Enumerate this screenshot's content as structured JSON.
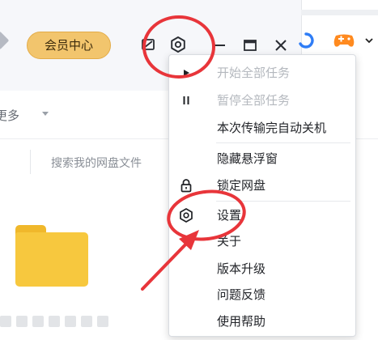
{
  "window": {
    "vip_button": "会员中心",
    "icons": [
      "left-partial-icon",
      "mail-icon",
      "settings-icon",
      "minimize-icon",
      "maximize-icon",
      "close-icon"
    ]
  },
  "taskbar": {
    "icons": [
      "browser-icon",
      "game-controller-icon",
      "chevron-down-icon"
    ]
  },
  "toolbar": {
    "more_label": "更多"
  },
  "search": {
    "placeholder": "搜索我的网盘文件"
  },
  "menu": {
    "items": [
      {
        "label": "开始全部任务",
        "icon": "play-icon",
        "enabled": false
      },
      {
        "label": "暂停全部任务",
        "icon": "pause-icon",
        "enabled": false
      },
      {
        "label": "本次传输完自动关机",
        "icon": "",
        "enabled": true
      },
      {
        "label": "隐藏悬浮窗",
        "icon": "",
        "enabled": true
      },
      {
        "label": "锁定网盘",
        "icon": "lock-icon",
        "enabled": true
      },
      {
        "label": "设置",
        "icon": "settings-icon",
        "enabled": true
      },
      {
        "label": "关于",
        "icon": "",
        "enabled": true
      },
      {
        "label": "版本升级",
        "icon": "",
        "enabled": true
      },
      {
        "label": "问题反馈",
        "icon": "",
        "enabled": true
      },
      {
        "label": "使用帮助",
        "icon": "",
        "enabled": true
      }
    ]
  },
  "annotations": {
    "color": "#e8353a",
    "shapes": [
      "circle-around-settings-icon",
      "circle-around-settings-menu-item",
      "arrow-to-settings-menu-item"
    ]
  },
  "colors": {
    "vip_fill": "#f2c56d",
    "folder": "#f7c83e",
    "annotation_red": "#e8353a",
    "browser_blue": "#2f7df6",
    "game_orange": "#ff8a1f"
  }
}
